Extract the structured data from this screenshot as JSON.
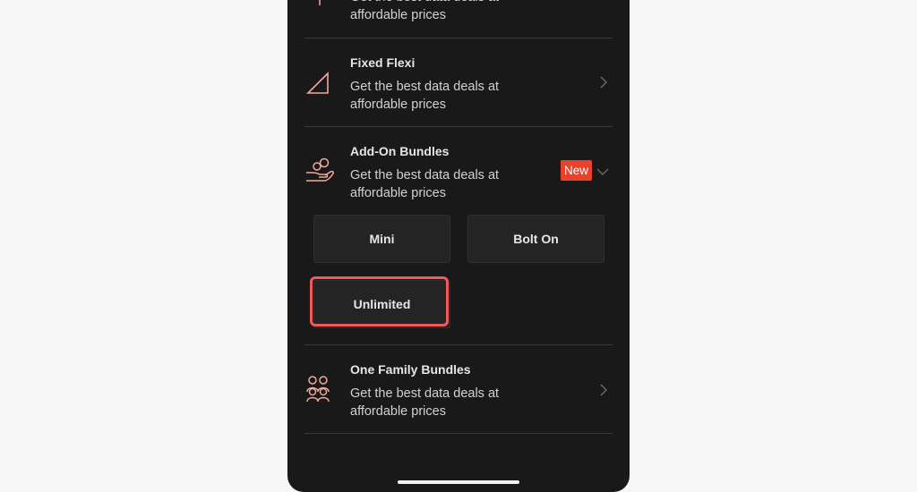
{
  "top_item": {
    "desc": "Get the best data deals at affordable prices"
  },
  "fixed_flexi": {
    "title": "Fixed Flexi",
    "desc": "Get the best data deals at affordable prices"
  },
  "addon": {
    "title": "Add-On Bundles",
    "desc": "Get the best data deals at affordable prices",
    "badge": "New"
  },
  "options": {
    "mini": "Mini",
    "bolt_on": "Bolt On",
    "unlimited": "Unlimited"
  },
  "family": {
    "title": "One Family Bundles",
    "desc": "Get the best data deals at affordable prices"
  },
  "colors": {
    "accent": "#e8412c",
    "icon": "#f0a9a0",
    "highlight": "#f05a5a",
    "background": "#191919"
  }
}
